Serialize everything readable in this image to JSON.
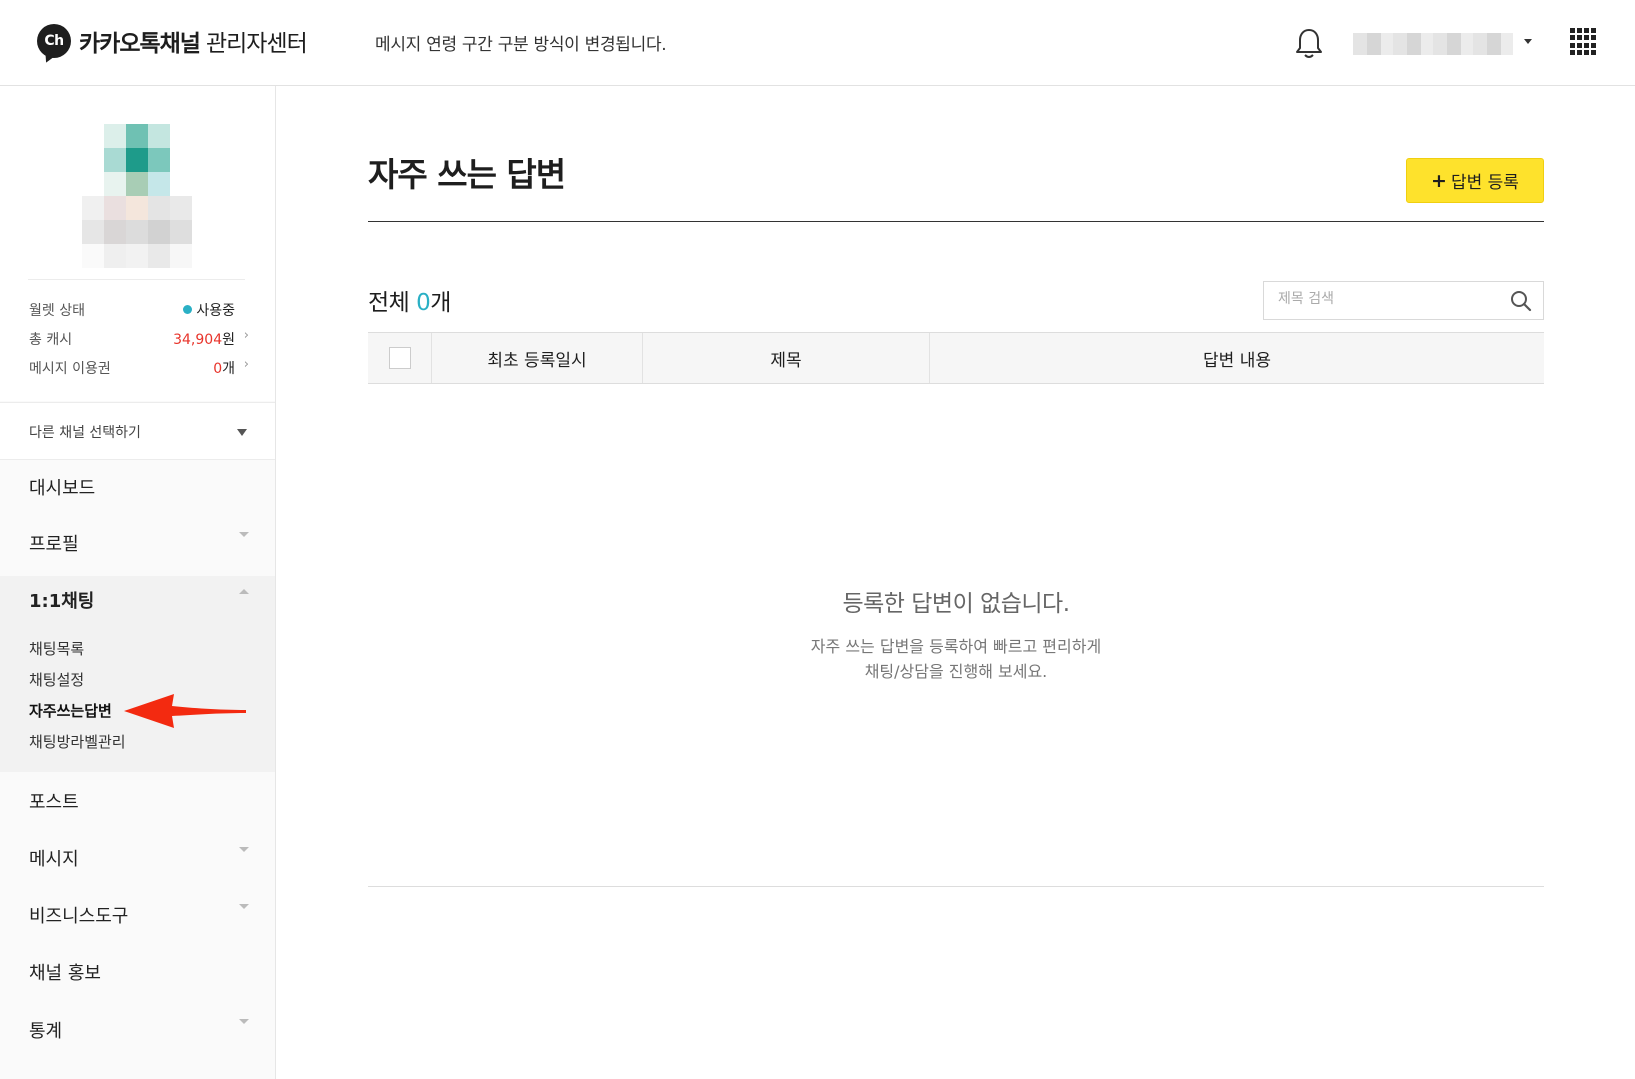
{
  "header": {
    "logo_badge": "Ch",
    "brand": "카카오톡채널",
    "brand_sub": "관리자센터",
    "notice": "메시지 연령 구간 구분 방식이 변경됩니다."
  },
  "sidebar": {
    "stats": {
      "wallet_label": "월렛 상태",
      "wallet_value": "사용중",
      "cash_label": "총 캐시",
      "cash_value": "34,904",
      "cash_unit": "원",
      "voucher_label": "메시지 이용권",
      "voucher_value": "0",
      "voucher_unit": "개"
    },
    "channel_select": "다른 채널 선택하기",
    "nav": {
      "dashboard": "대시보드",
      "profile": "프로필",
      "chat": "1:1채팅",
      "chat_list": "채팅목록",
      "chat_settings": "채팅설정",
      "saved_replies": "자주쓰는답변",
      "chat_labels": "채팅방라벨관리",
      "post": "포스트",
      "message": "메시지",
      "business_tools": "비즈니스도구",
      "promotion": "채널 홍보",
      "stats": "통계"
    }
  },
  "main": {
    "title": "자주 쓰는 답변",
    "add_button": "답변 등록",
    "add_button_plus": "+",
    "count_label": "전체 ",
    "count_value": "0",
    "count_unit": "개",
    "search_placeholder": "제목 검색",
    "columns": [
      "최초 등록일시",
      "제목",
      "답변 내용"
    ],
    "empty_title": "등록한 답변이 없습니다.",
    "empty_desc_line1": "자주 쓰는 답변을 등록하여 빠르고 편리하게",
    "empty_desc_line2": "채팅/상담을 진행해 보세요."
  },
  "colors": {
    "accent_yellow": "#fee22c",
    "accent_teal": "#2ab0c5",
    "alert_red": "#e8342b",
    "arrow_red": "#f32a10"
  },
  "icons": [
    "bell-icon",
    "apps-grid-icon",
    "search-icon",
    "chevron-right-icon",
    "caret-down-icon",
    "arrow-pointer-icon"
  ]
}
